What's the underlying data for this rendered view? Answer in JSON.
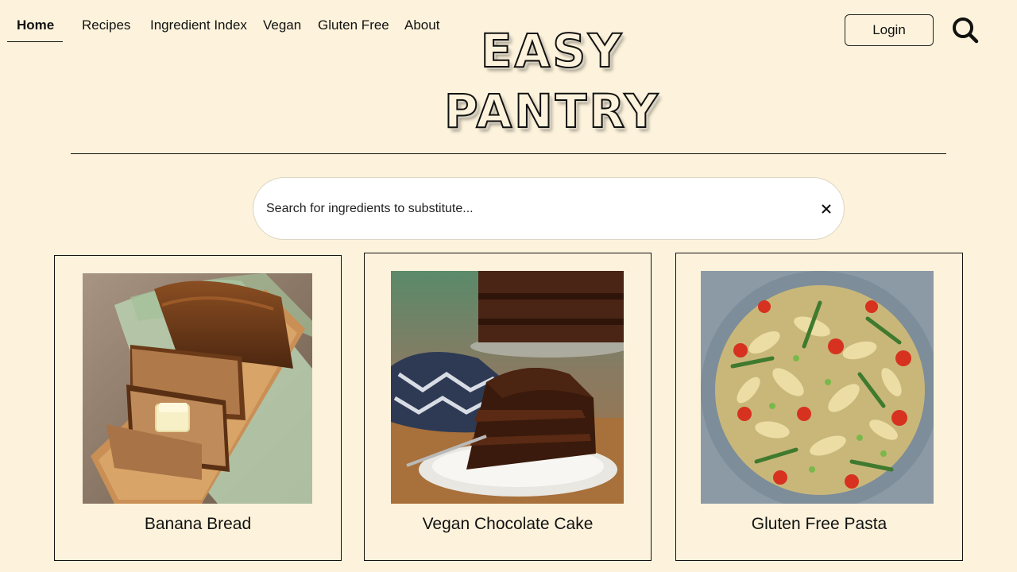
{
  "nav": {
    "items": [
      {
        "label": "Home",
        "active": true
      },
      {
        "label": "Recipes"
      },
      {
        "label": "Ingredient Index"
      },
      {
        "label": "Vegan"
      },
      {
        "label": "Gluten Free"
      },
      {
        "label": "About"
      }
    ],
    "login_label": "Login"
  },
  "logo": {
    "line1": "EASY",
    "line2": "PANTRY"
  },
  "search": {
    "placeholder": "Search for ingredients to substitute..."
  },
  "cards": [
    {
      "title": "Banana Bread"
    },
    {
      "title": "Vegan Chocolate Cake"
    },
    {
      "title": "Gluten Free Pasta"
    }
  ],
  "colors": {
    "background": "#fdf3dc",
    "ink": "#111111"
  }
}
